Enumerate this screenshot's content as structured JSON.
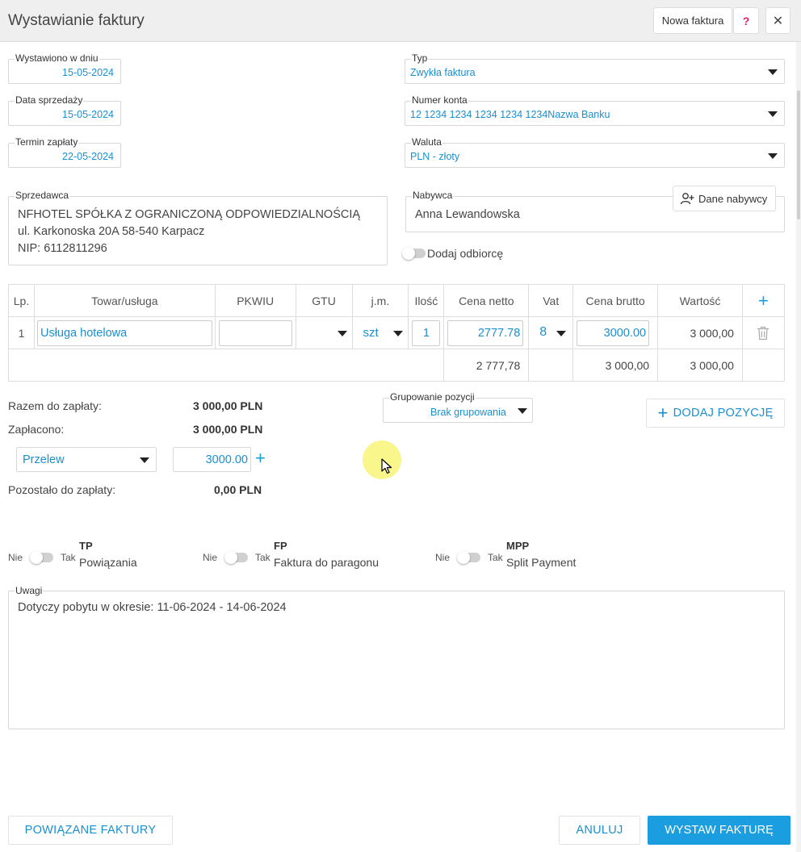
{
  "header": {
    "title": "Wystawianie faktury",
    "new_invoice_label": "Nowa faktura",
    "help_label": "?",
    "close_label": "✕"
  },
  "dates": {
    "issued": {
      "label": "Wystawiono w dniu",
      "value": "15-05-2024"
    },
    "sale": {
      "label": "Data sprzedaży",
      "value": "15-05-2024"
    },
    "due": {
      "label": "Termin zapłaty",
      "value": "22-05-2024"
    }
  },
  "type": {
    "label": "Typ",
    "value": "Zwykła faktura"
  },
  "account": {
    "label": "Numer konta",
    "value": "12 1234 1234 1234 1234 1234Nazwa Banku"
  },
  "currency": {
    "label": "Waluta",
    "value": "PLN - złoty"
  },
  "seller": {
    "label": "Sprzedawca",
    "name": "NFHOTEL SPÓŁKA Z OGRANICZONĄ ODPOWIEDZIALNOŚCIĄ",
    "address": "ul. Karkonoska 20A 58-540 Karpacz",
    "nip": "NIP: 6112811296"
  },
  "buyer": {
    "label": "Nabywca",
    "name": "Anna Lewandowska",
    "data_button": "Dane nabywcy",
    "add_recipient": "Dodaj odbiorcę"
  },
  "table": {
    "headers": [
      "Lp.",
      "Towar/usługa",
      "PKWIU",
      "GTU",
      "j.m.",
      "Ilość",
      "Cena netto",
      "Vat",
      "Cena brutto",
      "Wartość"
    ],
    "add_icon": "+",
    "row": {
      "lp": "1",
      "item": "Usługa hotelowa",
      "pkwiu": "",
      "gtu": "",
      "unit": "szt",
      "qty": "1",
      "net": "2777.78",
      "vat": "8",
      "gross": "3000.00",
      "value": "3 000,00"
    },
    "totals": {
      "net": "2 777,78",
      "gross": "3 000,00",
      "value": "3 000,00"
    }
  },
  "summary": {
    "total_label": "Razem do zapłaty:",
    "total_value": "3 000,00 PLN",
    "paid_label": "Zapłacono:",
    "paid_value": "3 000,00 PLN",
    "method": "Przelew",
    "amount": "3000.00",
    "remaining_label": "Pozostało do zapłaty:",
    "remaining_value": "0,00 PLN"
  },
  "grouping": {
    "label": "Grupowanie pozycji",
    "value": "Brak grupowania"
  },
  "add_position_label": "DODAJ POZYCJĘ",
  "flags": [
    {
      "no": "Nie",
      "yes": "Tak",
      "code": "TP",
      "desc": "Powiązania"
    },
    {
      "no": "Nie",
      "yes": "Tak",
      "code": "FP",
      "desc": "Faktura do paragonu"
    },
    {
      "no": "Nie",
      "yes": "Tak",
      "code": "MPP",
      "desc": "Split Payment"
    }
  ],
  "notes": {
    "label": "Uwagi",
    "value": "Dotyczy pobytu w okresie: 11-06-2024 - 14-06-2024"
  },
  "footer": {
    "related": "POWIĄZANE FAKTURY",
    "cancel": "ANULUJ",
    "issue": "WYSTAW FAKTURĘ"
  },
  "colors": {
    "accent": "#1a9ee0",
    "value_text": "#1a8fd0",
    "help": "#e0245e"
  }
}
